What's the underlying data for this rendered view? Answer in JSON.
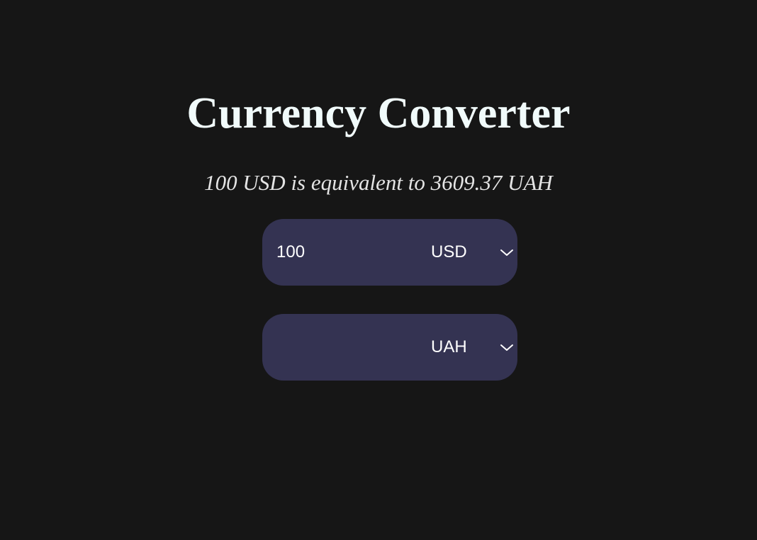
{
  "header": {
    "title": "Currency Converter"
  },
  "summary": {
    "text": "100 USD is equivalent to 3609.37 UAH"
  },
  "converter": {
    "from": {
      "amount": "100",
      "currency": "USD"
    },
    "to": {
      "amount": "",
      "currency": "UAH"
    }
  },
  "theme": {
    "background": "#161616",
    "panel": "#343352",
    "title_color": "#f1fbfb",
    "text_color": "#ffffff"
  },
  "icons": {
    "dropdown": "chevron-down-icon"
  }
}
